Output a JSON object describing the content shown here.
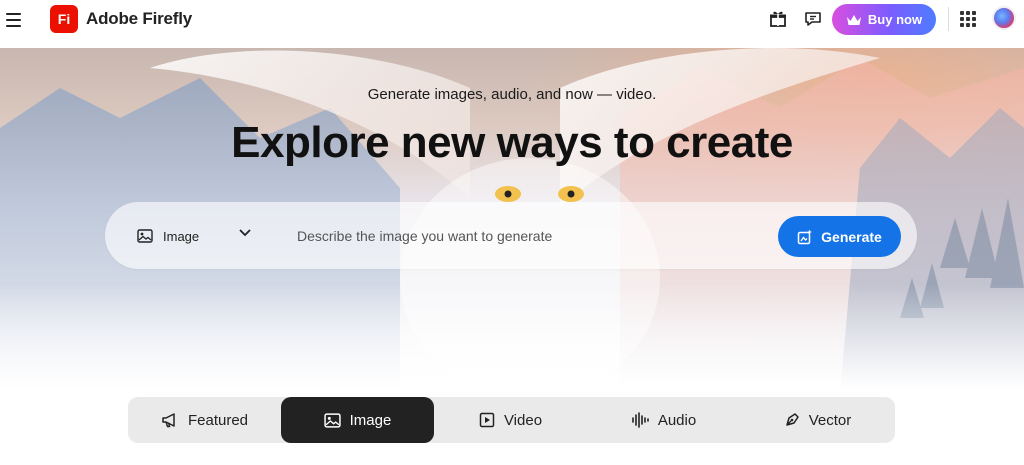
{
  "header": {
    "logo_text": "Fi",
    "app_title": "Adobe Firefly",
    "buy_now_label": "Buy now",
    "icons": [
      "menu-icon",
      "gift-icon",
      "chat-icon",
      "crown-icon",
      "apps-grid-icon",
      "avatar"
    ]
  },
  "hero": {
    "subtitle": "Generate images, audio, and now — video.",
    "title": "Explore new ways to create",
    "prompt": {
      "type_label": "Image",
      "placeholder": "Describe the image you want to generate",
      "value": "",
      "generate_label": "Generate"
    }
  },
  "tabs": [
    {
      "label": "Featured",
      "icon": "megaphone-icon",
      "active": false
    },
    {
      "label": "Image",
      "icon": "image-icon",
      "active": true
    },
    {
      "label": "Video",
      "icon": "video-icon",
      "active": false
    },
    {
      "label": "Audio",
      "icon": "audio-wave-icon",
      "active": false
    },
    {
      "label": "Vector",
      "icon": "pen-icon",
      "active": false
    }
  ],
  "colors": {
    "brand_red": "#eb1000",
    "generate_blue": "#1473e6",
    "active_tab": "#222222",
    "tab_bar": "#eaeaea"
  }
}
